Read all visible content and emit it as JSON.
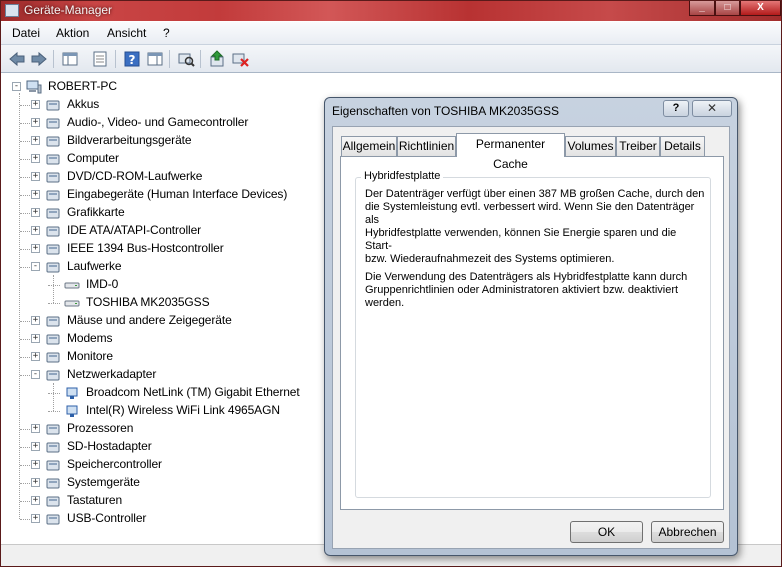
{
  "window": {
    "title": "Geräte-Manager",
    "min_glyph": "_",
    "max_glyph": "□",
    "close_glyph": "X"
  },
  "menu": [
    "Datei",
    "Aktion",
    "Ansicht",
    "?"
  ],
  "toolbar": {
    "icons": [
      "back-icon",
      "forward-icon",
      "show-hide-console-tree-icon",
      "properties-icon",
      "help-icon",
      "show-action-pane-icon",
      "scan-hardware-icon",
      "update-driver-icon",
      "uninstall-icon"
    ]
  },
  "tree": {
    "root": "ROBERT-PC",
    "items": [
      {
        "label": "Akkus",
        "expander": "+"
      },
      {
        "label": "Audio-, Video- und Gamecontroller",
        "expander": "+"
      },
      {
        "label": "Bildverarbeitungsgeräte",
        "expander": "+"
      },
      {
        "label": "Computer",
        "expander": "+"
      },
      {
        "label": "DVD/CD-ROM-Laufwerke",
        "expander": "+"
      },
      {
        "label": "Eingabegeräte (Human Interface Devices)",
        "expander": "+"
      },
      {
        "label": "Grafikkarte",
        "expander": "+"
      },
      {
        "label": "IDE ATA/ATAPI-Controller",
        "expander": "+"
      },
      {
        "label": "IEEE 1394 Bus-Hostcontroller",
        "expander": "+"
      },
      {
        "label": "Laufwerke",
        "expander": "-"
      },
      {
        "label": "IMD-0",
        "child": true
      },
      {
        "label": "TOSHIBA MK2035GSS",
        "child": true
      },
      {
        "label": "Mäuse und andere Zeigegeräte",
        "expander": "+"
      },
      {
        "label": "Modems",
        "expander": "+"
      },
      {
        "label": "Monitore",
        "expander": "+"
      },
      {
        "label": "Netzwerkadapter",
        "expander": "-"
      },
      {
        "label": "Broadcom NetLink (TM) Gigabit Ethernet",
        "child": true
      },
      {
        "label": "Intel(R) Wireless WiFi Link 4965AGN",
        "child": true
      },
      {
        "label": "Prozessoren",
        "expander": "+"
      },
      {
        "label": "SD-Hostadapter",
        "expander": "+"
      },
      {
        "label": "Speichercontroller",
        "expander": "+"
      },
      {
        "label": "Systemgeräte",
        "expander": "+"
      },
      {
        "label": "Tastaturen",
        "expander": "+"
      },
      {
        "label": "USB-Controller",
        "expander": "+"
      }
    ]
  },
  "dialog": {
    "title": "Eigenschaften von TOSHIBA MK2035GSS",
    "help_glyph": "?",
    "close_glyph": "✕",
    "tabs": [
      "Allgemein",
      "Richtlinien",
      "Permanenter Cache",
      "Volumes",
      "Treiber",
      "Details"
    ],
    "active_tab": "Permanenter Cache",
    "group_title": "Hybridfestplatte",
    "para1_lines": [
      "Der Datenträger verfügt über einen 387 MB großen Cache, durch den",
      "die Systemleistung evtl. verbessert wird. Wenn Sie den Datenträger als",
      "Hybridfestplatte verwenden, können Sie Energie sparen und die Start-",
      "bzw. Wiederaufnahmezeit des Systems optimieren."
    ],
    "para2_lines": [
      "Die Verwendung des Datenträgers als Hybridfestplatte kann durch",
      "Gruppenrichtlinien oder Administratoren aktiviert bzw. deaktiviert",
      "werden."
    ],
    "ok": "OK",
    "cancel": "Abbrechen"
  }
}
